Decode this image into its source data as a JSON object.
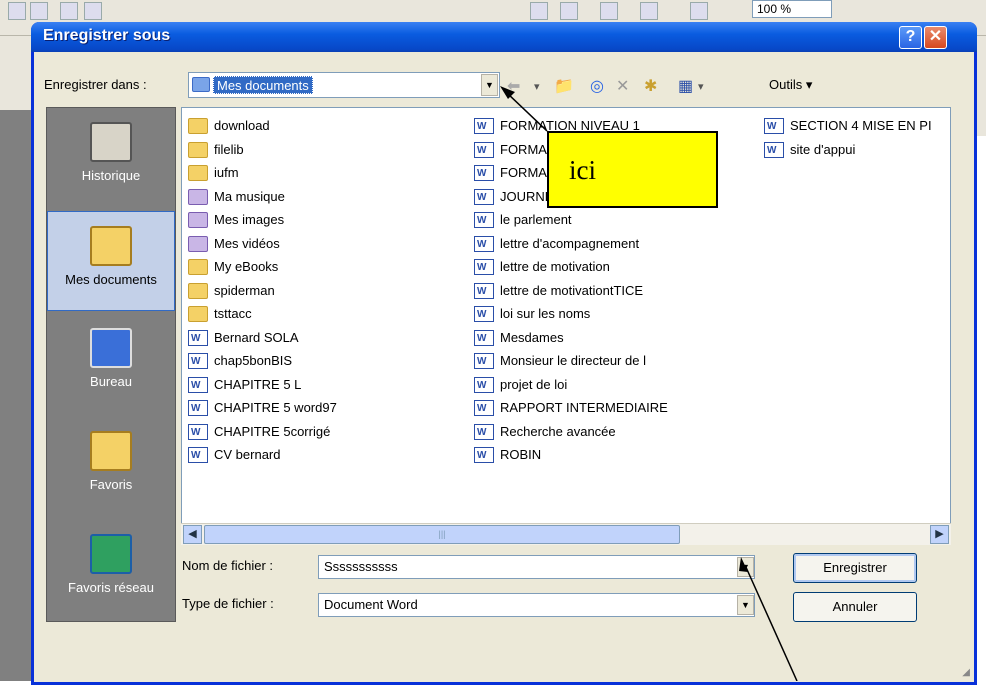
{
  "app": {
    "zoom": "100 %"
  },
  "dialog": {
    "title": "Enregistrer sous",
    "help_label": "?",
    "close_label": "✕",
    "save_in_label": "Enregistrer dans :",
    "save_in_value": "Mes documents",
    "tools_label": "Outils",
    "places": [
      {
        "label": "Historique",
        "icon": "history-icon"
      },
      {
        "label": "Mes documents",
        "icon": "my-documents-icon"
      },
      {
        "label": "Bureau",
        "icon": "desktop-icon"
      },
      {
        "label": "Favoris",
        "icon": "favorites-icon"
      },
      {
        "label": "Favoris réseau",
        "icon": "network-favorites-icon"
      }
    ],
    "files_col1": [
      {
        "name": "download",
        "type": "folder"
      },
      {
        "name": "filelib",
        "type": "folder"
      },
      {
        "name": "iufm",
        "type": "folder"
      },
      {
        "name": "Ma musique",
        "type": "special"
      },
      {
        "name": "Mes images",
        "type": "special"
      },
      {
        "name": "Mes vidéos",
        "type": "special"
      },
      {
        "name": "My eBooks",
        "type": "folder"
      },
      {
        "name": "spiderman",
        "type": "folder"
      },
      {
        "name": "tsttacc",
        "type": "folder"
      },
      {
        "name": "Bernard SOLA",
        "type": "word"
      },
      {
        "name": "chap5bonBIS",
        "type": "word"
      },
      {
        "name": "CHAPITRE 5 L",
        "type": "word"
      },
      {
        "name": "CHAPITRE 5 word97",
        "type": "word"
      },
      {
        "name": "CHAPITRE 5corrigé",
        "type": "word"
      },
      {
        "name": "CV bernard",
        "type": "word"
      }
    ],
    "files_col2": [
      {
        "name": "FORMATION NIVEAU 1",
        "type": "word"
      },
      {
        "name": "FORMA",
        "type": "word"
      },
      {
        "name": "FORMA                    QUE",
        "type": "word"
      },
      {
        "name": "JOURNEE SPECIALE APV",
        "type": "word"
      },
      {
        "name": "le parlement",
        "type": "word"
      },
      {
        "name": "lettre d'acompagnement",
        "type": "word"
      },
      {
        "name": "lettre de motivation",
        "type": "word"
      },
      {
        "name": "lettre de motivationtTICE",
        "type": "word"
      },
      {
        "name": "loi sur les noms",
        "type": "word"
      },
      {
        "name": "Mesdames",
        "type": "word"
      },
      {
        "name": "Monsieur le directeur de l",
        "type": "word"
      },
      {
        "name": "projet de loi",
        "type": "word"
      },
      {
        "name": "RAPPORT INTERMEDIAIRE",
        "type": "word"
      },
      {
        "name": "Recherche avancée",
        "type": "word"
      },
      {
        "name": "ROBIN",
        "type": "word"
      }
    ],
    "files_col3": [
      {
        "name": "SECTION 4 MISE EN PI",
        "type": "word"
      },
      {
        "name": "site d'appui",
        "type": "word"
      }
    ],
    "filename_label": "Nom de fichier :",
    "filename_value": "Sssssssssss",
    "filetype_label": "Type de fichier :",
    "filetype_value": "Document Word",
    "save_button": "Enregistrer",
    "cancel_button": "Annuler"
  },
  "annotation": {
    "text": "ici"
  }
}
